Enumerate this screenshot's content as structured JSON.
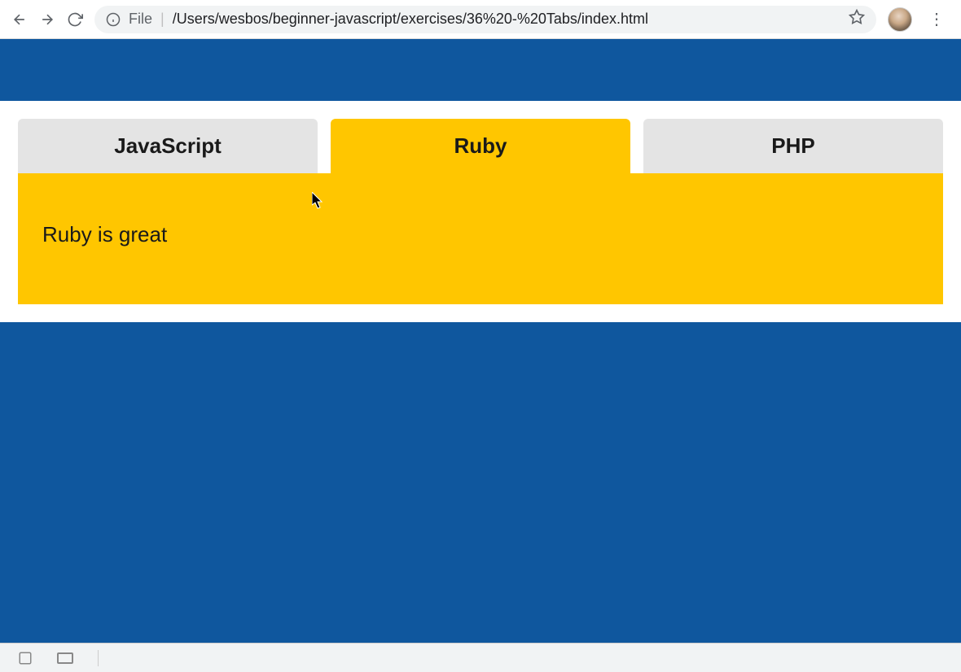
{
  "browser": {
    "file_label": "File",
    "url": "/Users/wesbos/beginner-javascript/exercises/36%20-%20Tabs/index.html"
  },
  "tabs": [
    {
      "label": "JavaScript",
      "active": false
    },
    {
      "label": "Ruby",
      "active": true
    },
    {
      "label": "PHP",
      "active": false
    }
  ],
  "panel": {
    "content": "Ruby is great"
  },
  "colors": {
    "page_bg": "#0f579e",
    "accent": "#ffc600",
    "tab_inactive": "#e4e4e4"
  }
}
